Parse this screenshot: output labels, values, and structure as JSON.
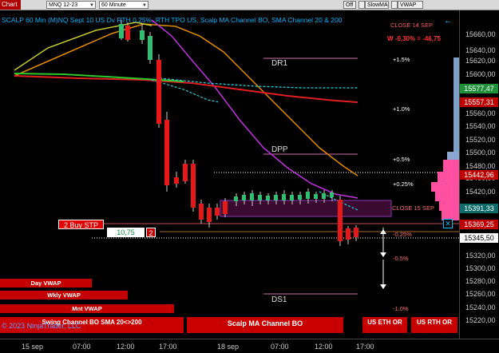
{
  "toolbar": {
    "chart_button": "Chart",
    "instrument": "MNQ 12-23",
    "interval": "60 Minute",
    "off_label": "Off",
    "indicator1": "SlowMA",
    "indicator2": "VWAP"
  },
  "header_text": "SCALP 60 Min (M)NQ Sept 10 US Dv RTH 0.25%, RTH TPO US, Scalp MA Channel BO, SMA Channel 20 & 200",
  "close14": "CLOSE 14 SEP",
  "pnl": "W -0,30% = -46,75",
  "close15": "CLOSE 15 SEP",
  "levels": {
    "dr1": "DR1",
    "dpp": "DPP",
    "ds1": "DS1"
  },
  "percents": [
    "+1.5%",
    "+1.0%",
    "+0.5%",
    "+0.25%",
    "-0.25%",
    "-0.5%",
    "-1.0%"
  ],
  "price_ticks": [
    "15660,00",
    "15640,00",
    "15620,00",
    "15600,00",
    "15560,00",
    "15540,00",
    "15520,00",
    "15500,00",
    "15480,00",
    "15460,00",
    "15420,00",
    "15320,00",
    "15300,00",
    "15280,00",
    "15260,00",
    "15240,00",
    "15220,00"
  ],
  "price_boxes": {
    "p1": "15577,47",
    "p2": "15557,31",
    "p3": "15442,96",
    "p4": "15391,33",
    "p5": "15369,25",
    "p6": "15345,50"
  },
  "colors": {
    "green_box": "#1f8f3a",
    "teal_box": "#0f6a6a",
    "red_box": "#c00000",
    "pink_box": "#ff4fa0"
  },
  "order": {
    "buy_stp": "2 Buy STP",
    "price": "10,75",
    "qty": "2"
  },
  "left_buttons": {
    "day_vwap": "Day VWAP",
    "wkly_vwap": "Wkly VWAP",
    "mnt_vwap": "Mnt VWAP"
  },
  "bottom_buttons": {
    "swing": "Swing Channel BO SMA 20<>200",
    "scalp": "Scalp MA Channel BO",
    "us_eth": "US ETH OR",
    "us_rth": "US RTH OR"
  },
  "copyright": "© 2023 NinjaTrader, LLC",
  "x_labels": [
    "15 sep",
    "07:00",
    "12:00",
    "17:00",
    "18 sep",
    "07:00",
    "12:00",
    "17:00"
  ]
}
